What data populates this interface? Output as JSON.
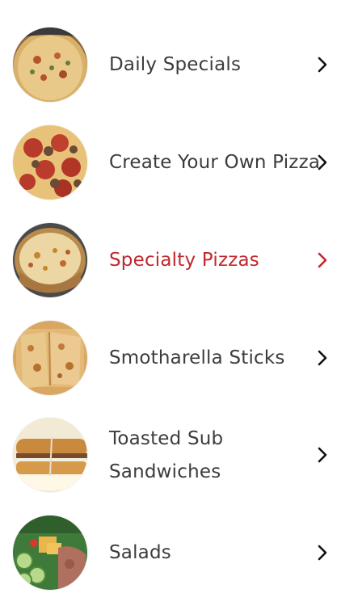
{
  "menu": {
    "items": [
      {
        "label": "Daily Specials",
        "icon": "pizza-overhead-photo"
      },
      {
        "label": "Create Your Own Pizza",
        "icon": "pepperoni-sausage-pizza-photo"
      },
      {
        "label": "Specialty Pizzas",
        "icon": "deep-dish-pizza-photo"
      },
      {
        "label": "Smotharella Sticks",
        "icon": "cheese-sticks-photo"
      },
      {
        "label": "Toasted Sub Sandwiches",
        "icon": "sub-sandwich-photo"
      },
      {
        "label": "Salads",
        "icon": "salad-photo"
      }
    ],
    "active_index": 2
  },
  "colors": {
    "text": "#3c3c3c",
    "active": "#c2272d",
    "chevron": "#111111",
    "background": "#ffffff"
  }
}
